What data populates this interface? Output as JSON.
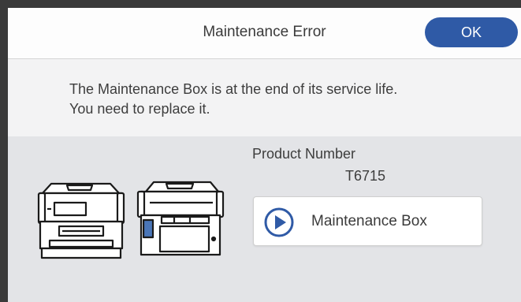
{
  "header": {
    "title": "Maintenance Error",
    "ok_label": "OK"
  },
  "message": {
    "line1": "The Maintenance Box is at the end of its service life.",
    "line2": "You need to replace it."
  },
  "product": {
    "number_label": "Product Number",
    "number_value": "T6715"
  },
  "action": {
    "label": "Maintenance Box",
    "icon": "play-circle-icon"
  },
  "colors": {
    "accent": "#2f5aa6",
    "frame": "#3a3a3a",
    "panel": "#e3e4e7"
  }
}
